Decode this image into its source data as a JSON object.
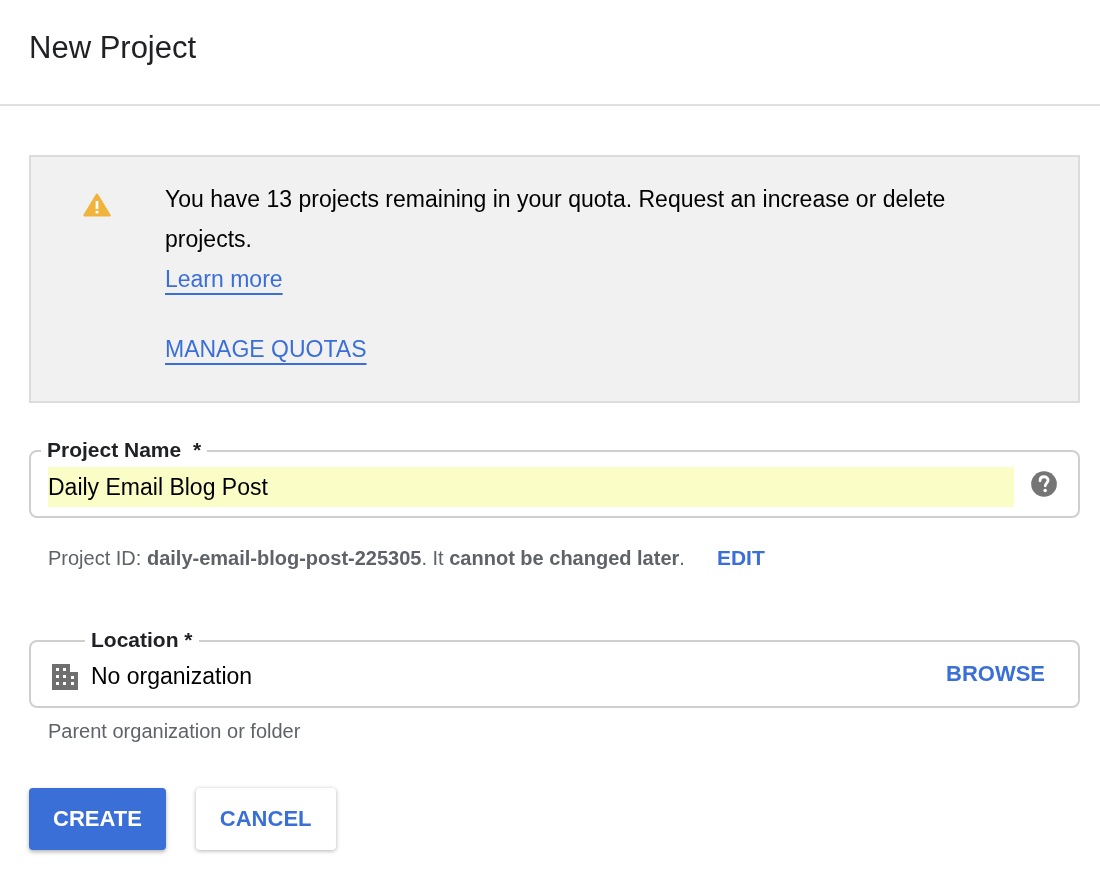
{
  "dialog": {
    "title": "New Project"
  },
  "notice": {
    "message": "You have 13 projects remaining in your quota. Request an increase or delete projects.",
    "link": "Learn more",
    "action": "MANAGE QUOTAS"
  },
  "project_name": {
    "label": "Project Name  *",
    "value": "Daily Email Blog Post",
    "autofilled": true
  },
  "project_id": {
    "text": "Project ID: **daily-email-blog-post-225305**. It **cannot be changed later**.",
    "action": "EDIT"
  },
  "location": {
    "label": "Location *",
    "value": "No organization",
    "action": "BROWSE",
    "helper": "Parent organization or folder"
  },
  "buttons": [
    {
      "label": "CREATE",
      "kind": "primary"
    },
    {
      "label": "CANCEL",
      "kind": "secondary"
    }
  ]
}
